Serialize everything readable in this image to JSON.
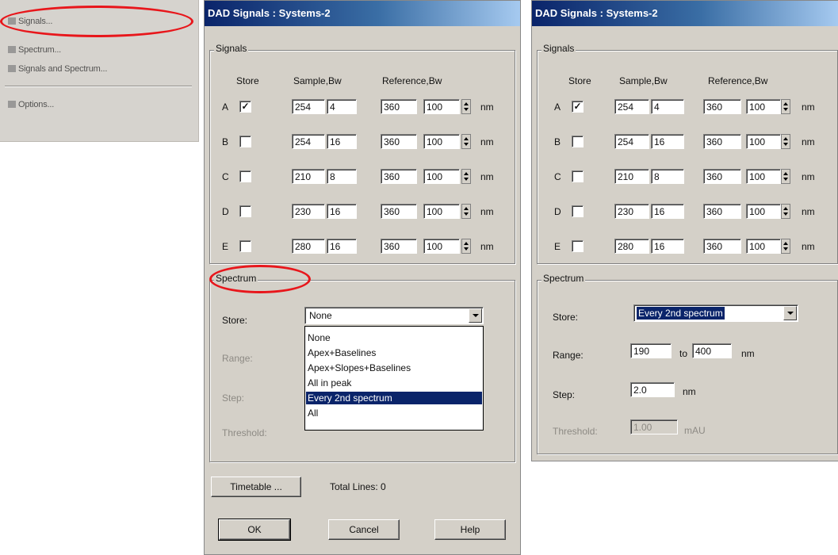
{
  "colors": {
    "title_bar": "#0a246a",
    "dialog_face": "#d4d0c8",
    "highlight": "#0a246a",
    "annotation_ring": "#e8161b"
  },
  "menu_fragment": {
    "items": [
      "Signals...",
      "Spectrum...",
      "Signals and Spectrum...",
      "Options..."
    ]
  },
  "dialog_left": {
    "title": "DAD Signals : Systems-2",
    "signals": {
      "group_label": "Signals",
      "headers": {
        "store": "Store",
        "sample": "Sample,Bw",
        "reference": "Reference,Bw"
      },
      "unit": "nm",
      "rows": [
        {
          "label": "A",
          "checked": true,
          "sample": "254",
          "sample_bw": "4",
          "ref": "360",
          "ref_bw": "100"
        },
        {
          "label": "B",
          "checked": false,
          "sample": "254",
          "sample_bw": "16",
          "ref": "360",
          "ref_bw": "100"
        },
        {
          "label": "C",
          "checked": false,
          "sample": "210",
          "sample_bw": "8",
          "ref": "360",
          "ref_bw": "100"
        },
        {
          "label": "D",
          "checked": false,
          "sample": "230",
          "sample_bw": "16",
          "ref": "360",
          "ref_bw": "100"
        },
        {
          "label": "E",
          "checked": false,
          "sample": "280",
          "sample_bw": "16",
          "ref": "360",
          "ref_bw": "100"
        }
      ]
    },
    "spectrum": {
      "group_label": "Spectrum",
      "store_label": "Store:",
      "store_value": "None",
      "range_label": "Range:",
      "step_label": "Step:",
      "threshold_label": "Threshold:",
      "options": [
        "None",
        "Apex+Baselines",
        "Apex+Slopes+Baselines",
        "All in peak",
        "Every 2nd spectrum",
        "All"
      ],
      "highlighted_option": "Every 2nd spectrum"
    },
    "timetable_button": "Timetable ...",
    "total_lines": "Total Lines: 0",
    "ok_button": "OK",
    "cancel_button": "Cancel",
    "help_button": "Help"
  },
  "dialog_right": {
    "title": "DAD Signals : Systems-2",
    "signals": {
      "group_label": "Signals",
      "headers": {
        "store": "Store",
        "sample": "Sample,Bw",
        "reference": "Reference,Bw"
      },
      "unit": "nm",
      "rows": [
        {
          "label": "A",
          "checked": true,
          "sample": "254",
          "sample_bw": "4",
          "ref": "360",
          "ref_bw": "100"
        },
        {
          "label": "B",
          "checked": false,
          "sample": "254",
          "sample_bw": "16",
          "ref": "360",
          "ref_bw": "100"
        },
        {
          "label": "C",
          "checked": false,
          "sample": "210",
          "sample_bw": "8",
          "ref": "360",
          "ref_bw": "100"
        },
        {
          "label": "D",
          "checked": false,
          "sample": "230",
          "sample_bw": "16",
          "ref": "360",
          "ref_bw": "100"
        },
        {
          "label": "E",
          "checked": false,
          "sample": "280",
          "sample_bw": "16",
          "ref": "360",
          "ref_bw": "100"
        }
      ]
    },
    "spectrum": {
      "group_label": "Spectrum",
      "store_label": "Store:",
      "store_value": "Every 2nd spectrum",
      "range_label": "Range:",
      "range_from": "190",
      "range_to_label": "to",
      "range_to": "400",
      "range_unit": "nm",
      "step_label": "Step:",
      "step_value": "2.0",
      "step_unit": "nm",
      "threshold_label": "Threshold:",
      "threshold_value": "1.00",
      "threshold_unit": "mAU"
    }
  }
}
